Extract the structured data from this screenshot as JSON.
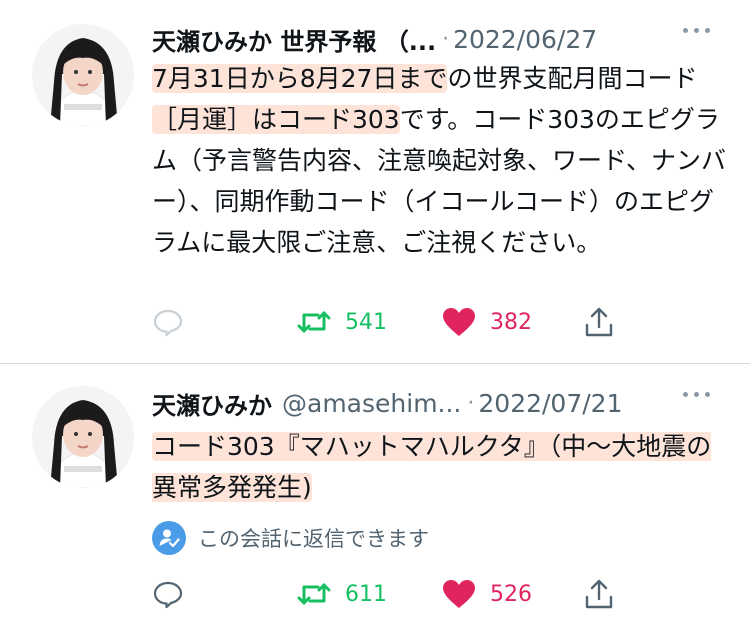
{
  "tweets": [
    {
      "author_name": "天瀬ひみか 世界予報 （...",
      "handle": "",
      "date": "2022/06/27",
      "text_parts": [
        {
          "text": "7月31日から8月27日まで",
          "highlight": true
        },
        {
          "text": "の世界支配月間コード",
          "highlight": false
        },
        {
          "text": "［月運］はコード303",
          "highlight": true
        },
        {
          "text": "です。コード303のエピグラム（予言警告内容、注意喚起対象、ワード、ナンバー）、同期作動コード（イコールコード）のエピグラムに最大限ご注意、ご注視ください。",
          "highlight": false
        }
      ],
      "retweets": "541",
      "likes": "382",
      "reply_restriction": ""
    },
    {
      "author_name": "天瀬ひみか",
      "handle": "@amasehim...",
      "date": "2022/07/21",
      "text_parts": [
        {
          "text": "コード303『マハットマハルクタ』（中〜大地震の異常多発発生)",
          "highlight": true
        }
      ],
      "retweets": "611",
      "likes": "526",
      "reply_restriction": "この会話に返信できます"
    }
  ],
  "colors": {
    "highlight": "#fde3d8",
    "retweet": "#17bf63",
    "like": "#e0245e",
    "secondary_text": "#536471",
    "restrict_badge": "#4a9be8"
  },
  "icons": {
    "reply": "reply-icon",
    "retweet": "retweet-icon",
    "like": "heart-icon",
    "share": "share-icon",
    "more": "more-icon",
    "restrict": "person-check-icon"
  }
}
